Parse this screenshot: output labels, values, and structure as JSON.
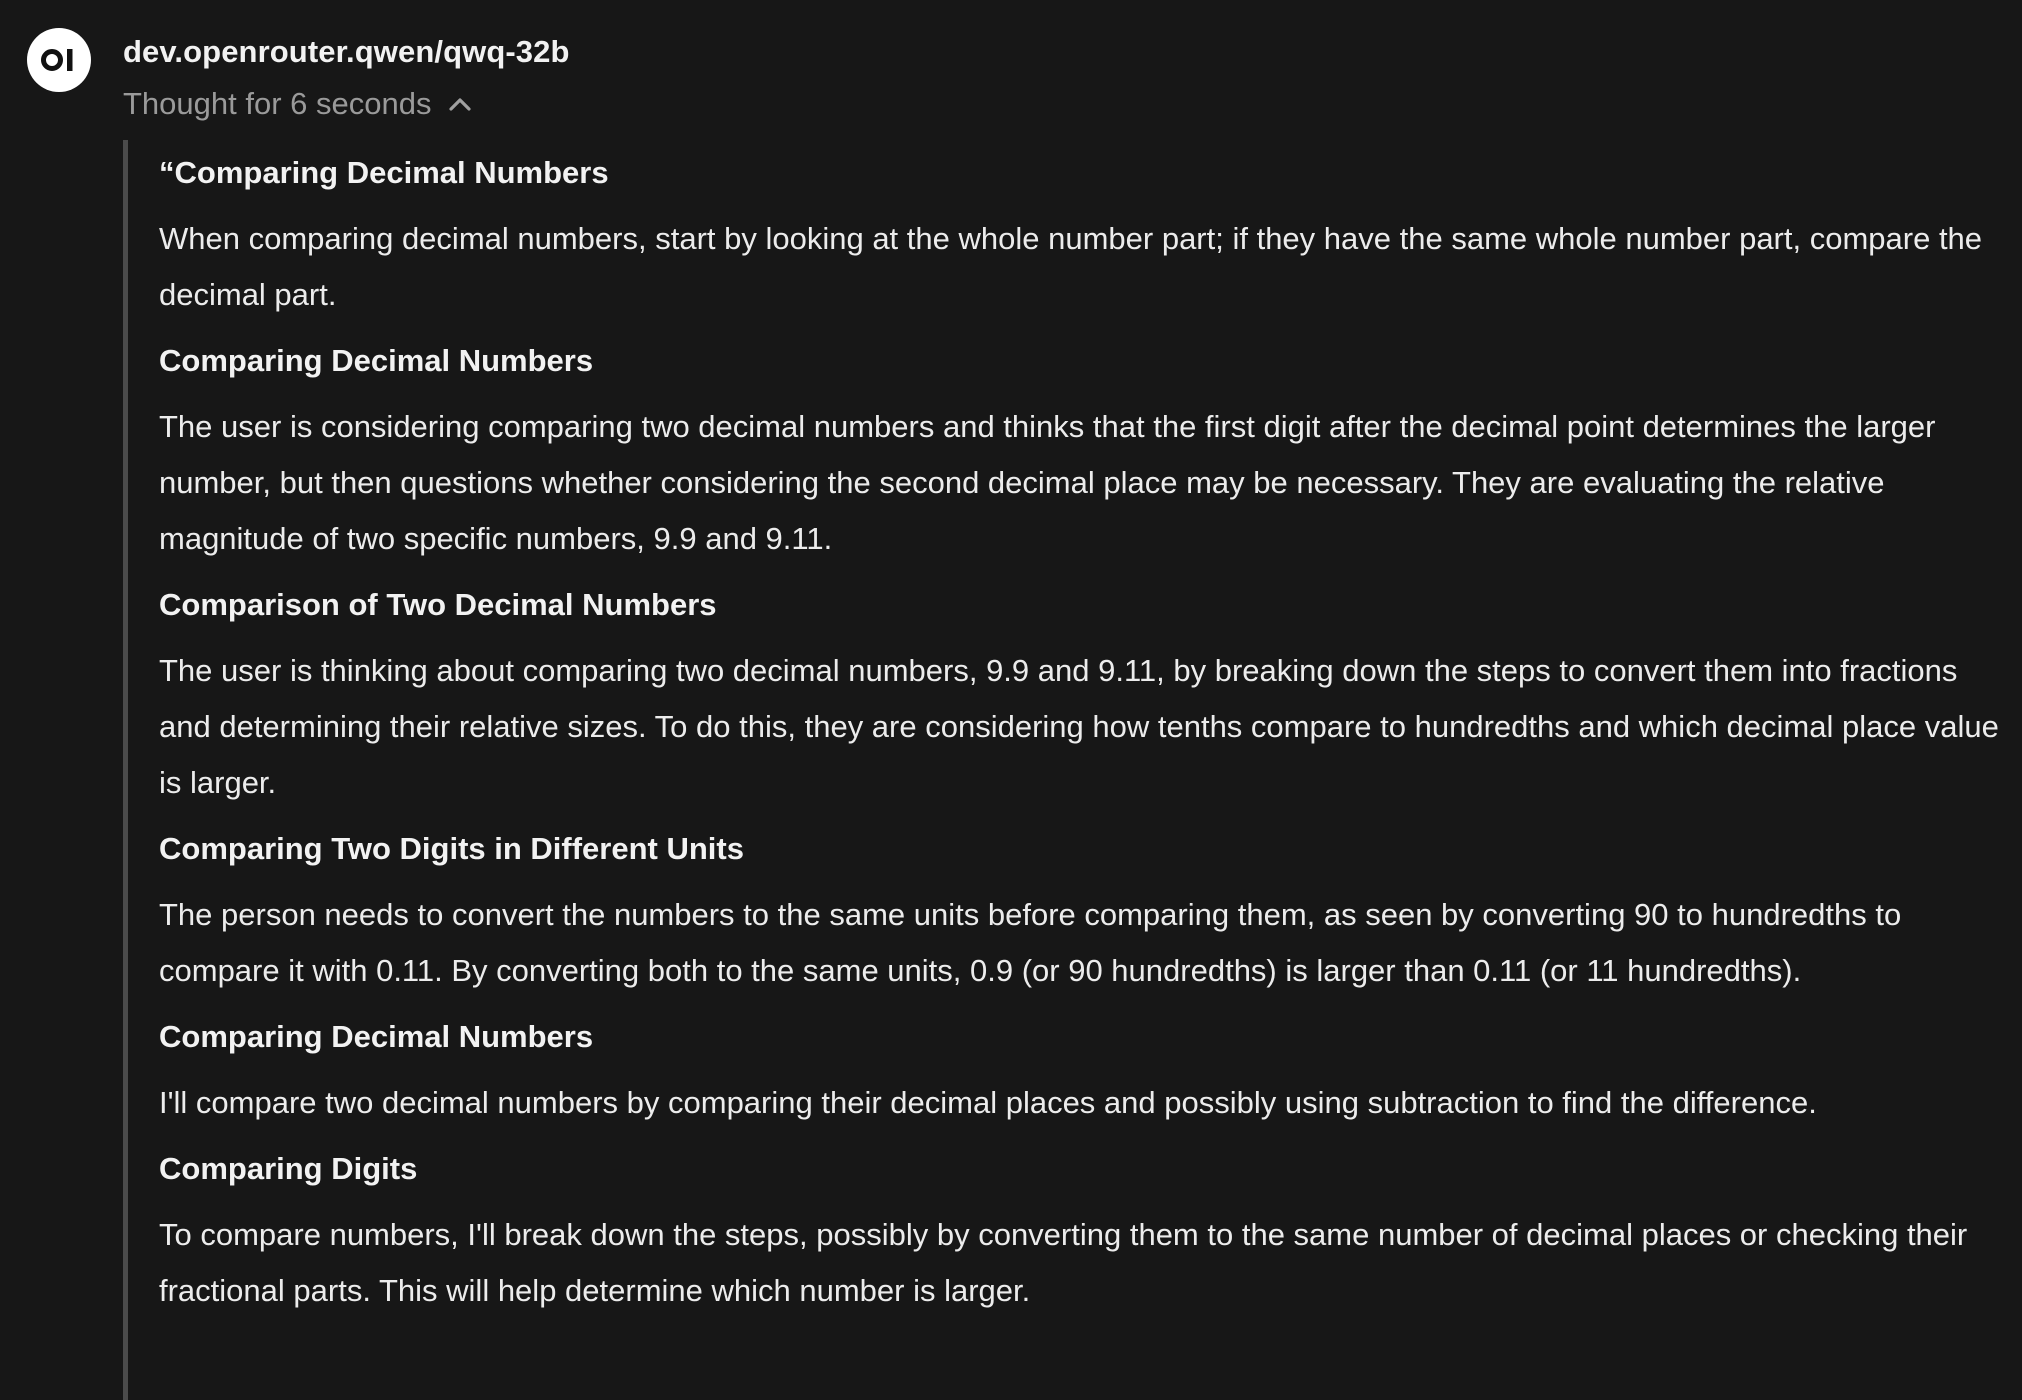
{
  "header": {
    "avatar_label": "OI",
    "model_name": "dev.openrouter.qwen/qwq-32b",
    "thought_label": "Thought for 6 seconds",
    "toggle_icon": "chevron-up-icon"
  },
  "thinking": {
    "sections": [
      {
        "title": "“Comparing Decimal Numbers",
        "body": "When comparing decimal numbers, start by looking at the whole number part; if they have the same whole number part, compare the decimal part."
      },
      {
        "title": "Comparing Decimal Numbers",
        "body": "The user is considering comparing two decimal numbers and thinks that the first digit after the decimal point determines the larger number, but then questions whether considering the second decimal place may be necessary. They are evaluating the relative magnitude of two specific numbers, 9.9 and 9.11."
      },
      {
        "title": "Comparison of Two Decimal Numbers",
        "body": "The user is thinking about comparing two decimal numbers, 9.9 and 9.11, by breaking down the steps to convert them into fractions and determining their relative sizes. To do this, they are considering how tenths compare to hundredths and which decimal place value is larger."
      },
      {
        "title": "Comparing Two Digits in Different Units",
        "body": "The person needs to convert the numbers to the same units before comparing them, as seen by converting 90 to hundredths to compare it with 0.11. By converting both to the same units, 0.9 (or 90 hundredths) is larger than 0.11 (or 11 hundredths)."
      },
      {
        "title": "Comparing Decimal Numbers",
        "body": "I'll compare two decimal numbers by comparing their decimal places and possibly using subtraction to find the difference."
      },
      {
        "title": "Comparing Digits",
        "body": "To compare numbers, I'll break down the steps, possibly by converting them to the same number of decimal places or checking their fractional parts. This will help determine which number is larger."
      }
    ]
  }
}
